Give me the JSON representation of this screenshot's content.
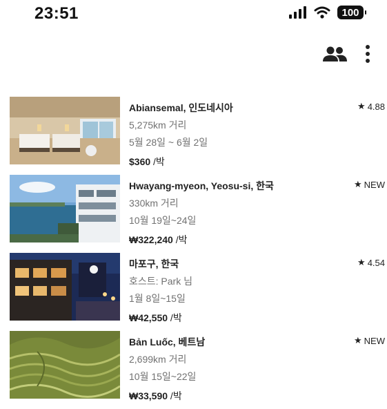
{
  "status_bar": {
    "time": "23:51",
    "battery": "100"
  },
  "listings": [
    {
      "title": "Abiansemal, 인도네시아",
      "line1": "5,275km 거리",
      "line2": "5월 28일 ~ 6월 2일",
      "price": "$360",
      "unit": " /박",
      "rating": "4.88"
    },
    {
      "title": "Hwayang-myeon, Yeosu-si, 한국",
      "line1": "330km 거리",
      "line2": "10월 19일~24일",
      "price": "₩322,240",
      "unit": " /박",
      "rating": "NEW"
    },
    {
      "title": "마포구, 한국",
      "line1": "호스트: Park 님",
      "line2": "1월 8일~15일",
      "price": "₩42,550",
      "unit": " /박",
      "rating": "4.54"
    },
    {
      "title": "Bản Luốc, 베트남",
      "line1": "2,699km 거리",
      "line2": "10월 15일~22일",
      "price": "₩33,590",
      "unit": " /박",
      "rating": "NEW"
    }
  ]
}
